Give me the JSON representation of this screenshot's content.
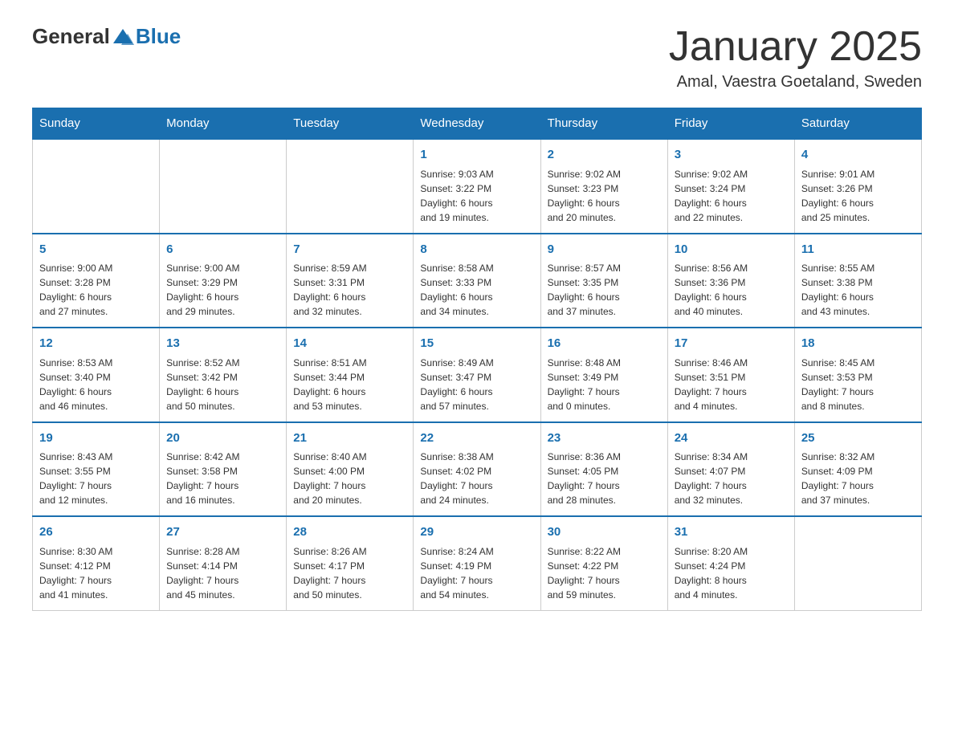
{
  "header": {
    "logo_general": "General",
    "logo_blue": "Blue",
    "month_title": "January 2025",
    "location": "Amal, Vaestra Goetaland, Sweden"
  },
  "days_of_week": [
    "Sunday",
    "Monday",
    "Tuesday",
    "Wednesday",
    "Thursday",
    "Friday",
    "Saturday"
  ],
  "weeks": [
    [
      {
        "day": "",
        "info": ""
      },
      {
        "day": "",
        "info": ""
      },
      {
        "day": "",
        "info": ""
      },
      {
        "day": "1",
        "info": "Sunrise: 9:03 AM\nSunset: 3:22 PM\nDaylight: 6 hours\nand 19 minutes."
      },
      {
        "day": "2",
        "info": "Sunrise: 9:02 AM\nSunset: 3:23 PM\nDaylight: 6 hours\nand 20 minutes."
      },
      {
        "day": "3",
        "info": "Sunrise: 9:02 AM\nSunset: 3:24 PM\nDaylight: 6 hours\nand 22 minutes."
      },
      {
        "day": "4",
        "info": "Sunrise: 9:01 AM\nSunset: 3:26 PM\nDaylight: 6 hours\nand 25 minutes."
      }
    ],
    [
      {
        "day": "5",
        "info": "Sunrise: 9:00 AM\nSunset: 3:28 PM\nDaylight: 6 hours\nand 27 minutes."
      },
      {
        "day": "6",
        "info": "Sunrise: 9:00 AM\nSunset: 3:29 PM\nDaylight: 6 hours\nand 29 minutes."
      },
      {
        "day": "7",
        "info": "Sunrise: 8:59 AM\nSunset: 3:31 PM\nDaylight: 6 hours\nand 32 minutes."
      },
      {
        "day": "8",
        "info": "Sunrise: 8:58 AM\nSunset: 3:33 PM\nDaylight: 6 hours\nand 34 minutes."
      },
      {
        "day": "9",
        "info": "Sunrise: 8:57 AM\nSunset: 3:35 PM\nDaylight: 6 hours\nand 37 minutes."
      },
      {
        "day": "10",
        "info": "Sunrise: 8:56 AM\nSunset: 3:36 PM\nDaylight: 6 hours\nand 40 minutes."
      },
      {
        "day": "11",
        "info": "Sunrise: 8:55 AM\nSunset: 3:38 PM\nDaylight: 6 hours\nand 43 minutes."
      }
    ],
    [
      {
        "day": "12",
        "info": "Sunrise: 8:53 AM\nSunset: 3:40 PM\nDaylight: 6 hours\nand 46 minutes."
      },
      {
        "day": "13",
        "info": "Sunrise: 8:52 AM\nSunset: 3:42 PM\nDaylight: 6 hours\nand 50 minutes."
      },
      {
        "day": "14",
        "info": "Sunrise: 8:51 AM\nSunset: 3:44 PM\nDaylight: 6 hours\nand 53 minutes."
      },
      {
        "day": "15",
        "info": "Sunrise: 8:49 AM\nSunset: 3:47 PM\nDaylight: 6 hours\nand 57 minutes."
      },
      {
        "day": "16",
        "info": "Sunrise: 8:48 AM\nSunset: 3:49 PM\nDaylight: 7 hours\nand 0 minutes."
      },
      {
        "day": "17",
        "info": "Sunrise: 8:46 AM\nSunset: 3:51 PM\nDaylight: 7 hours\nand 4 minutes."
      },
      {
        "day": "18",
        "info": "Sunrise: 8:45 AM\nSunset: 3:53 PM\nDaylight: 7 hours\nand 8 minutes."
      }
    ],
    [
      {
        "day": "19",
        "info": "Sunrise: 8:43 AM\nSunset: 3:55 PM\nDaylight: 7 hours\nand 12 minutes."
      },
      {
        "day": "20",
        "info": "Sunrise: 8:42 AM\nSunset: 3:58 PM\nDaylight: 7 hours\nand 16 minutes."
      },
      {
        "day": "21",
        "info": "Sunrise: 8:40 AM\nSunset: 4:00 PM\nDaylight: 7 hours\nand 20 minutes."
      },
      {
        "day": "22",
        "info": "Sunrise: 8:38 AM\nSunset: 4:02 PM\nDaylight: 7 hours\nand 24 minutes."
      },
      {
        "day": "23",
        "info": "Sunrise: 8:36 AM\nSunset: 4:05 PM\nDaylight: 7 hours\nand 28 minutes."
      },
      {
        "day": "24",
        "info": "Sunrise: 8:34 AM\nSunset: 4:07 PM\nDaylight: 7 hours\nand 32 minutes."
      },
      {
        "day": "25",
        "info": "Sunrise: 8:32 AM\nSunset: 4:09 PM\nDaylight: 7 hours\nand 37 minutes."
      }
    ],
    [
      {
        "day": "26",
        "info": "Sunrise: 8:30 AM\nSunset: 4:12 PM\nDaylight: 7 hours\nand 41 minutes."
      },
      {
        "day": "27",
        "info": "Sunrise: 8:28 AM\nSunset: 4:14 PM\nDaylight: 7 hours\nand 45 minutes."
      },
      {
        "day": "28",
        "info": "Sunrise: 8:26 AM\nSunset: 4:17 PM\nDaylight: 7 hours\nand 50 minutes."
      },
      {
        "day": "29",
        "info": "Sunrise: 8:24 AM\nSunset: 4:19 PM\nDaylight: 7 hours\nand 54 minutes."
      },
      {
        "day": "30",
        "info": "Sunrise: 8:22 AM\nSunset: 4:22 PM\nDaylight: 7 hours\nand 59 minutes."
      },
      {
        "day": "31",
        "info": "Sunrise: 8:20 AM\nSunset: 4:24 PM\nDaylight: 8 hours\nand 4 minutes."
      },
      {
        "day": "",
        "info": ""
      }
    ]
  ]
}
